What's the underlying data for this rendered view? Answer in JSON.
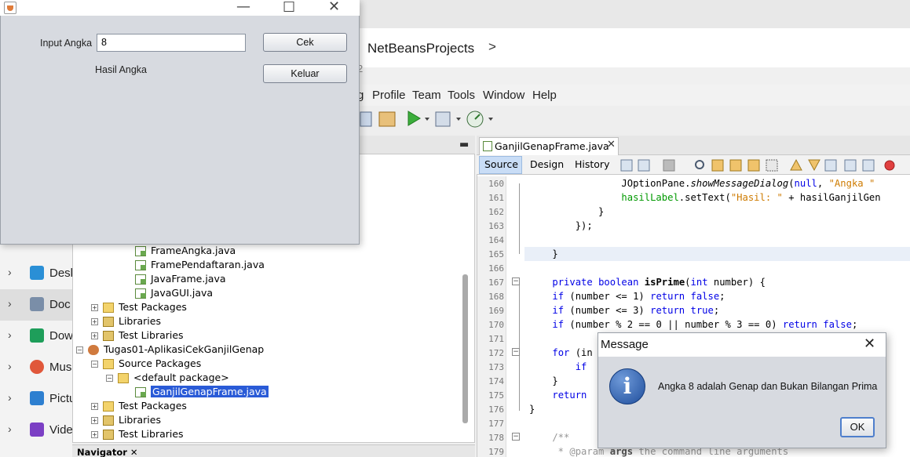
{
  "explorer": {
    "breadcrumb": "NetBeansProjects",
    "breadcrumb_chevron": ">",
    "sidebar": [
      {
        "label": "Desk",
        "icon": "desktop-icon",
        "color": "#2a8fd6"
      },
      {
        "label": "Doc",
        "icon": "documents-icon",
        "color": "#7a8ea8",
        "selected": true
      },
      {
        "label": "Dow",
        "icon": "downloads-icon",
        "color": "#1e9e5a"
      },
      {
        "label": "Mus",
        "icon": "music-icon",
        "color": "#e0573a"
      },
      {
        "label": "Pictu",
        "icon": "pictures-icon",
        "color": "#2d7fd0"
      },
      {
        "label": "Vide",
        "icon": "videos-icon",
        "color": "#7b3fc4"
      }
    ]
  },
  "netbeans": {
    "title_fragment": "2",
    "menu": [
      "g",
      "Profile",
      "Team",
      "Tools",
      "Window",
      "Help"
    ],
    "editor_tab": "GanjilGenapFrame.java",
    "subtabs": [
      "Source",
      "Design",
      "History"
    ],
    "navigator_label": "Navigator",
    "tree": [
      {
        "label": "FrameAngka.java",
        "icon": "java"
      },
      {
        "label": "FramePendaftaran.java",
        "icon": "java"
      },
      {
        "label": "JavaFrame.java",
        "icon": "java"
      },
      {
        "label": "JavaGUI.java",
        "icon": "java"
      },
      {
        "label": "Test Packages",
        "icon": "pkg"
      },
      {
        "label": "Libraries",
        "icon": "lib"
      },
      {
        "label": "Test Libraries",
        "icon": "lib"
      },
      {
        "label": "Tugas01-AplikasiCekGanjilGenap",
        "icon": "proj"
      },
      {
        "label": "Source Packages",
        "icon": "pkg"
      },
      {
        "label": "<default package>",
        "icon": "pkg"
      },
      {
        "label": "GanjilGenapFrame.java",
        "icon": "java",
        "selected": true
      },
      {
        "label": "Test Packages",
        "icon": "pkg"
      },
      {
        "label": "Libraries",
        "icon": "lib"
      },
      {
        "label": "Test Libraries",
        "icon": "lib"
      }
    ],
    "line_numbers": [
      "160",
      "161",
      "162",
      "163",
      "164",
      "165",
      "166",
      "167",
      "168",
      "169",
      "170",
      "171",
      "172",
      "173",
      "174",
      "175",
      "176",
      "177",
      "178",
      "179"
    ]
  },
  "app": {
    "input_label": "Input Angka",
    "input_value": "8",
    "check_button": "Cek",
    "exit_button": "Keluar",
    "result_label": "Hasil Angka"
  },
  "message": {
    "title": "Message",
    "text": "Angka 8 adalah Genap dan Bukan Bilangan Prima",
    "ok_button": "OK"
  },
  "colors": {
    "keyword": "#0000e6",
    "string": "#ce7b00",
    "selection": "#2a5bd7",
    "dialog_bg": "#d7dae0"
  }
}
